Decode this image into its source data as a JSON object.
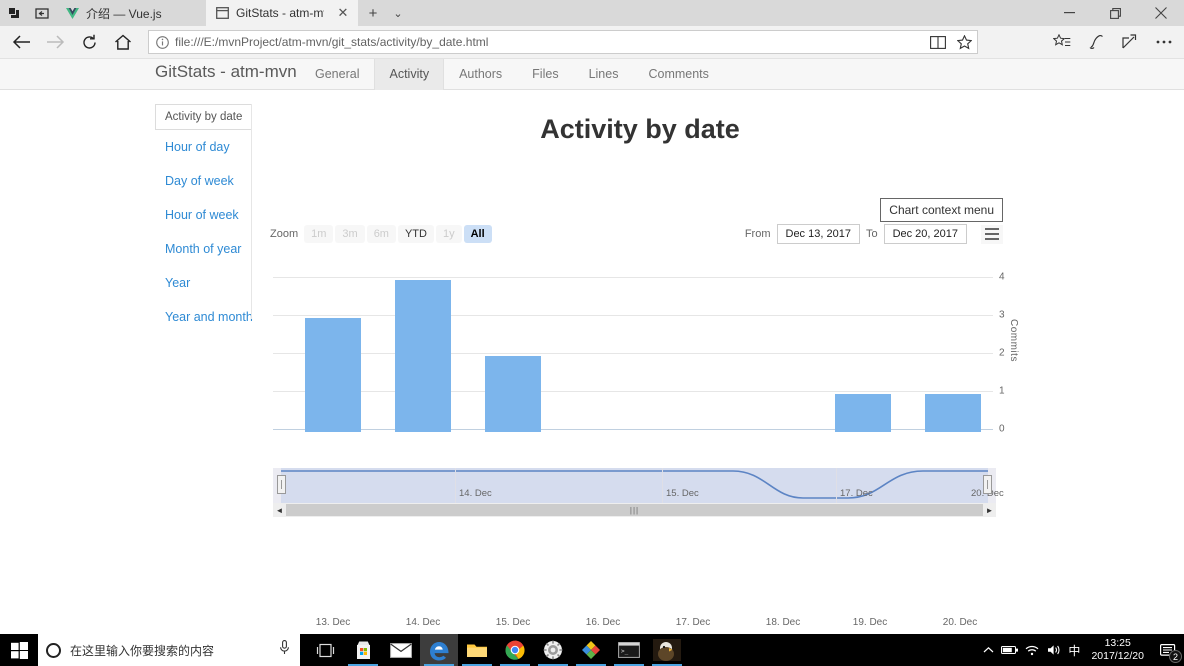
{
  "browser": {
    "tabs": [
      {
        "title": "介绍 — Vue.js",
        "favicon": "vue-logo-icon",
        "active": false
      },
      {
        "title": "GitStats - atm-mvn",
        "favicon": "window-icon",
        "active": true
      }
    ],
    "new_tab_label": "+",
    "tab_list_label": "⌄",
    "close_label": "✕",
    "window_controls": {
      "minimize": "—",
      "restore": "❐",
      "close": "✕"
    },
    "url": "file:///E:/mvnProject/atm-mvn/git_stats/activity/by_date.html",
    "nav_icons": [
      "back-arrow-icon",
      "forward-arrow-icon",
      "refresh-icon",
      "home-icon"
    ],
    "omnibox_icons": [
      "info-icon",
      "reading-view-icon",
      "favorite-star-icon"
    ],
    "toolbar_icons": [
      "favorites-hub-icon",
      "web-notes-icon",
      "share-icon",
      "more-icon"
    ]
  },
  "site": {
    "brand": "GitStats - atm-mvn",
    "nav_tabs": [
      {
        "label": "General",
        "selected": false
      },
      {
        "label": "Activity",
        "selected": true
      },
      {
        "label": "Authors",
        "selected": false
      },
      {
        "label": "Files",
        "selected": false
      },
      {
        "label": "Lines",
        "selected": false
      },
      {
        "label": "Comments",
        "selected": false
      }
    ],
    "sidebar": {
      "current": "Activity by date",
      "items": [
        "Hour of day",
        "Day of week",
        "Hour of week",
        "Month of year",
        "Year",
        "Year and month"
      ]
    }
  },
  "chart_ui": {
    "zoom_label": "Zoom",
    "zoom_buttons": [
      {
        "label": "1m",
        "enabled": false,
        "active": false
      },
      {
        "label": "3m",
        "enabled": false,
        "active": false
      },
      {
        "label": "6m",
        "enabled": false,
        "active": false
      },
      {
        "label": "YTD",
        "enabled": true,
        "active": false
      },
      {
        "label": "1y",
        "enabled": false,
        "active": false
      },
      {
        "label": "All",
        "enabled": true,
        "active": true
      }
    ],
    "from_label": "From",
    "from_value": "Dec 13, 2017",
    "to_label": "To",
    "to_value": "Dec 20, 2017",
    "context_menu_tooltip": "Chart context menu",
    "context_menu_icon": "hamburger-menu-icon",
    "navigator_labels": [
      "14. Dec",
      "15. Dec",
      "17. Dec",
      "20. Dec"
    ],
    "scrollbar_left_arrow": "◄",
    "scrollbar_right_arrow": "►",
    "scrollbar_grip": "|||"
  },
  "chart_data": {
    "type": "bar",
    "title": "Activity by date",
    "xlabel": "",
    "ylabel": "Commits",
    "categories": [
      "13. Dec",
      "14. Dec",
      "15. Dec",
      "16. Dec",
      "17. Dec",
      "18. Dec",
      "19. Dec",
      "20. Dec"
    ],
    "values": [
      3,
      4,
      2,
      0,
      0,
      0,
      1,
      1
    ],
    "ylim": [
      0,
      4
    ],
    "yticks": [
      0,
      1,
      2,
      3,
      4
    ],
    "series_color": "#7cb5ec",
    "grid": true,
    "legend": false,
    "y_axis_position": "right"
  },
  "taskbar": {
    "search_placeholder": "在这里输入你要搜索的内容",
    "start_icon": "windows-start-icon",
    "cortana_icon": "cortana-circle-icon",
    "mic_icon": "microphone-icon",
    "pinned": [
      "task-view-icon",
      "microsoft-store-icon",
      "mail-icon",
      "edge-browser-icon",
      "file-explorer-icon",
      "chrome-browser-icon",
      "gear-app-icon",
      "colorful-diamond-app-icon",
      "terminal-icon",
      "eagle-photo-icon"
    ],
    "tray_icons": [
      "show-hidden-icons-icon",
      "battery-icon",
      "wifi-icon",
      "volume-icon"
    ],
    "ime_label": "中",
    "time": "13:25",
    "date": "2017/12/20",
    "notification_icon": "notification-icon",
    "notification_count": "2"
  }
}
